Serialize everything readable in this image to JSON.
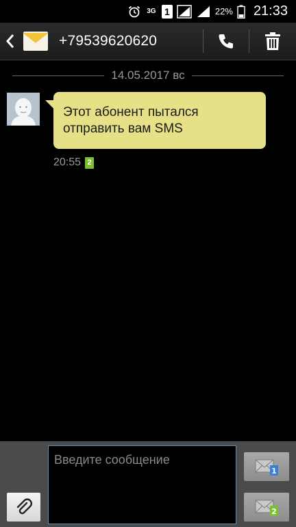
{
  "status_bar": {
    "network": "3G",
    "sim_slot": "1",
    "battery_percent": "22%",
    "time": "21:33"
  },
  "header": {
    "contact": "+79539620620",
    "icons": [
      "back-arrow-icon",
      "messages-envelope-icon",
      "phone-icon",
      "trash-icon"
    ]
  },
  "conversation": {
    "date_label": "14.05.2017 вс",
    "messages": [
      {
        "text": "Этот абонент пытался отправить вам  SMS",
        "time": "20:55",
        "sim": "2"
      }
    ]
  },
  "compose": {
    "placeholder": "Введите сообщение",
    "send_sim_1": "1",
    "send_sim_2": "2"
  },
  "colors": {
    "bubble": "#e6e086",
    "sim2_badge": "#7fbf2f",
    "sim1_badge": "#3b7dd8",
    "input_border": "#5f8fb6"
  }
}
